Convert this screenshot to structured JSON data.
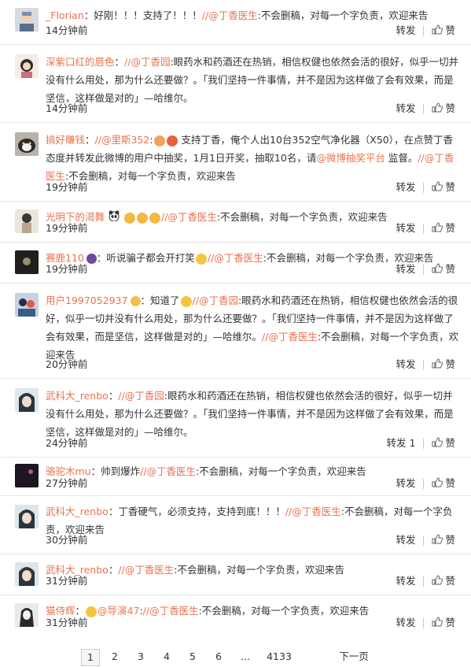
{
  "comments": [
    {
      "user": "_Florian",
      "pre": "：好刚！！！支持了！！！",
      "mention1": "//@丁香医生",
      "post1": ":不会删稿，对每一个字负责，欢迎来告",
      "extra": "",
      "time": "14分钟前",
      "repost": "转发",
      "like": "赞"
    },
    {
      "user": "深紫口红的唇色",
      "pre": "：",
      "mention1": "//@丁香园",
      "post1": ":眼药水和药酒还在热销，相信权健也依然会活的很好，似乎一切并没有什么用处，那为什么还要做？。「我们坚持一件事情，并不是因为这样做了会有效果，而是坚信，这样做是对的」—哈维尔。",
      "extra": "",
      "time": "14分钟前",
      "repost": "转发",
      "like": "赞"
    },
    {
      "user": "搞好賺钱",
      "pre": "：",
      "mention1": "//@里斯352",
      "post1": ":",
      "post1b": " 支持丁香，俺个人出10台352空气净化器（X50），在点赞丁香态度并转发此微博的用户中抽奖，1月1日开奖，抽取10名，请",
      "mention2": "@微博抽奖平台",
      "post2": " 监督。",
      "mention3": "//@丁香医生",
      "post3": ":不会删稿，对每一个字负责，欢迎来告",
      "time": "19分钟前",
      "repost": "转发",
      "like": "赞"
    },
    {
      "user": "光明下的渴舞",
      "pre": "",
      "mention1": "//@丁香医生",
      "post1": ":不会删稿，对每一个字负责，欢迎来告",
      "extra": "",
      "time": "19分钟前",
      "repost": "转发",
      "like": "赞"
    },
    {
      "user": "赛鹿110",
      "pre": "：听说骗子都会开打笑",
      "mention1": "//@丁香医生",
      "post1": ":不会删稿，对每一个字负责，欢迎来告",
      "extra": "",
      "time": "19分钟前",
      "repost": "转发",
      "like": "赞"
    },
    {
      "user": "用户1997052937",
      "pre": "：知道了",
      "mention1": "//@丁香园",
      "post1": ":眼药水和药酒还在热销，相信权健也依然会活的很好，似乎一切并没有什么用处，那为什么还要做？。「我们坚持一件事情，并不是因为这样做了会有效果，而是坚信，这样做是对的」—哈维尔。",
      "mention2": "//@丁香医生",
      "post2": ":不会删稿，对每一个字负责，欢迎来告",
      "time": "20分钟前",
      "repost": "转发",
      "like": "赞"
    },
    {
      "user": "武科大_renbo",
      "pre": "：",
      "mention1": "//@丁香园",
      "post1": ":眼药水和药酒还在热销，相信权健也依然会活的很好，似乎一切并没有什么用处，那为什么还要做？。「我们坚持一件事情，并不是因为这样做了会有效果，而是坚信，这样做是对的」—哈维尔。",
      "extra": "",
      "time": "24分钟前",
      "repost": "转发 1",
      "like": "赞"
    },
    {
      "user": "骆驼木mu",
      "pre": "：帅到爆炸",
      "mention1": "//@丁香医生",
      "post1": ":不会删稿，对每一个字负责，欢迎来告",
      "extra": "",
      "time": "27分钟前",
      "repost": "转发",
      "like": "赞"
    },
    {
      "user": "武科大_renbo",
      "pre": "：丁香硬气，必须支持，支持到底！！！",
      "mention1": "//@丁香医生",
      "post1": ":不会删稿，对每一个字负责，欢迎来告",
      "extra": "",
      "time": "30分钟前",
      "repost": "转发",
      "like": "赞"
    },
    {
      "user": "武科大_renbo",
      "pre": "：",
      "mention1": "//@丁香医生",
      "post1": ":不会删稿，对每一个字负责，欢迎来告",
      "extra": "",
      "time": "31分钟前",
      "repost": "转发",
      "like": "赞"
    },
    {
      "user": "猫侍辉",
      "pre": "：",
      "mention1": "@导演47",
      "post1": ":",
      "mention2": "//@丁香医生",
      "post2": ":不会删稿，对每一个字负责，欢迎来告",
      "time": "31分钟前",
      "repost": "转发",
      "like": "赞"
    }
  ],
  "pager": {
    "pages": [
      "1",
      "2",
      "3",
      "4",
      "5",
      "6",
      "4133"
    ],
    "ellipsis": "...",
    "next": "下一页",
    "active": "1"
  },
  "colors": {
    "accent": "#eb7350",
    "text": "#333333",
    "divider": "#e6e6e6"
  }
}
